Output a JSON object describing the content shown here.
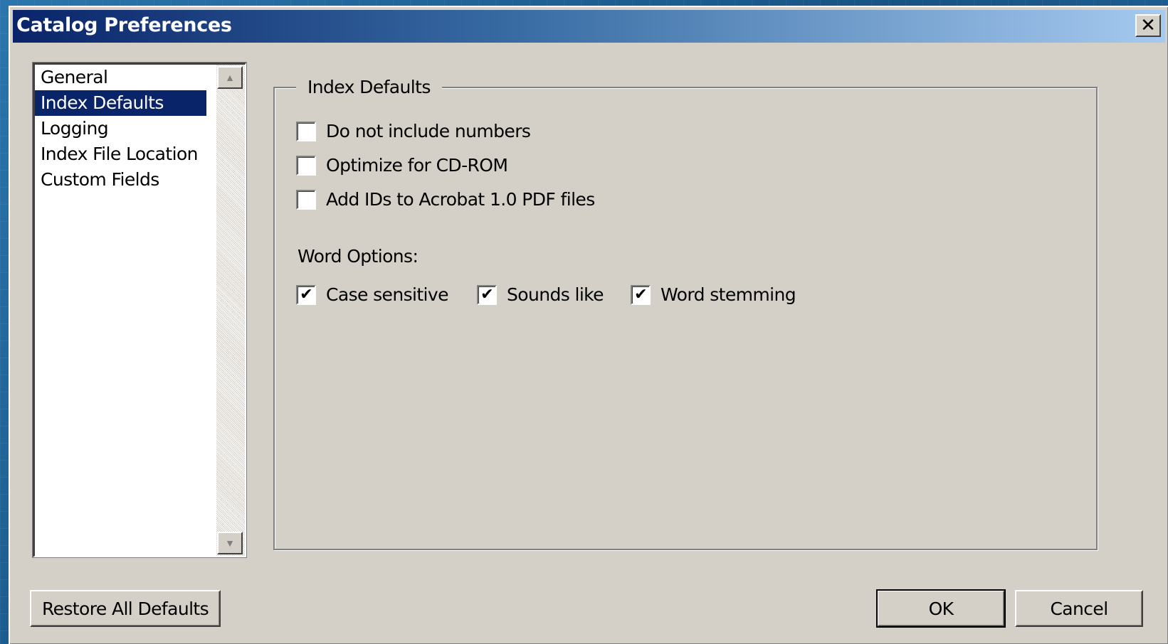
{
  "window": {
    "title": "Catalog Preferences",
    "close_glyph": "✕"
  },
  "sidebar": {
    "items": [
      {
        "label": "General",
        "selected": false
      },
      {
        "label": "Index Defaults",
        "selected": true
      },
      {
        "label": "Logging",
        "selected": false
      },
      {
        "label": "Index File Location",
        "selected": false
      },
      {
        "label": "Custom Fields",
        "selected": false
      }
    ]
  },
  "panel": {
    "title": "Index Defaults",
    "options": [
      {
        "label": "Do not include numbers",
        "checked": false
      },
      {
        "label": "Optimize for CD-ROM",
        "checked": false
      },
      {
        "label": "Add IDs to Acrobat 1.0 PDF files",
        "checked": false
      }
    ],
    "word_options_label": "Word Options:",
    "word_options": [
      {
        "label": "Case sensitive",
        "checked": true
      },
      {
        "label": "Sounds like",
        "checked": true
      },
      {
        "label": "Word stemming",
        "checked": true
      }
    ]
  },
  "buttons": {
    "restore": "Restore All Defaults",
    "ok": "OK",
    "cancel": "Cancel"
  },
  "icons": {
    "check": "✔",
    "scroll_up": "▲",
    "scroll_down": "▼"
  },
  "colors": {
    "titlebar_start": "#0a246a",
    "selection": "#0a246a",
    "dialog_bg": "#d4d0c8"
  }
}
